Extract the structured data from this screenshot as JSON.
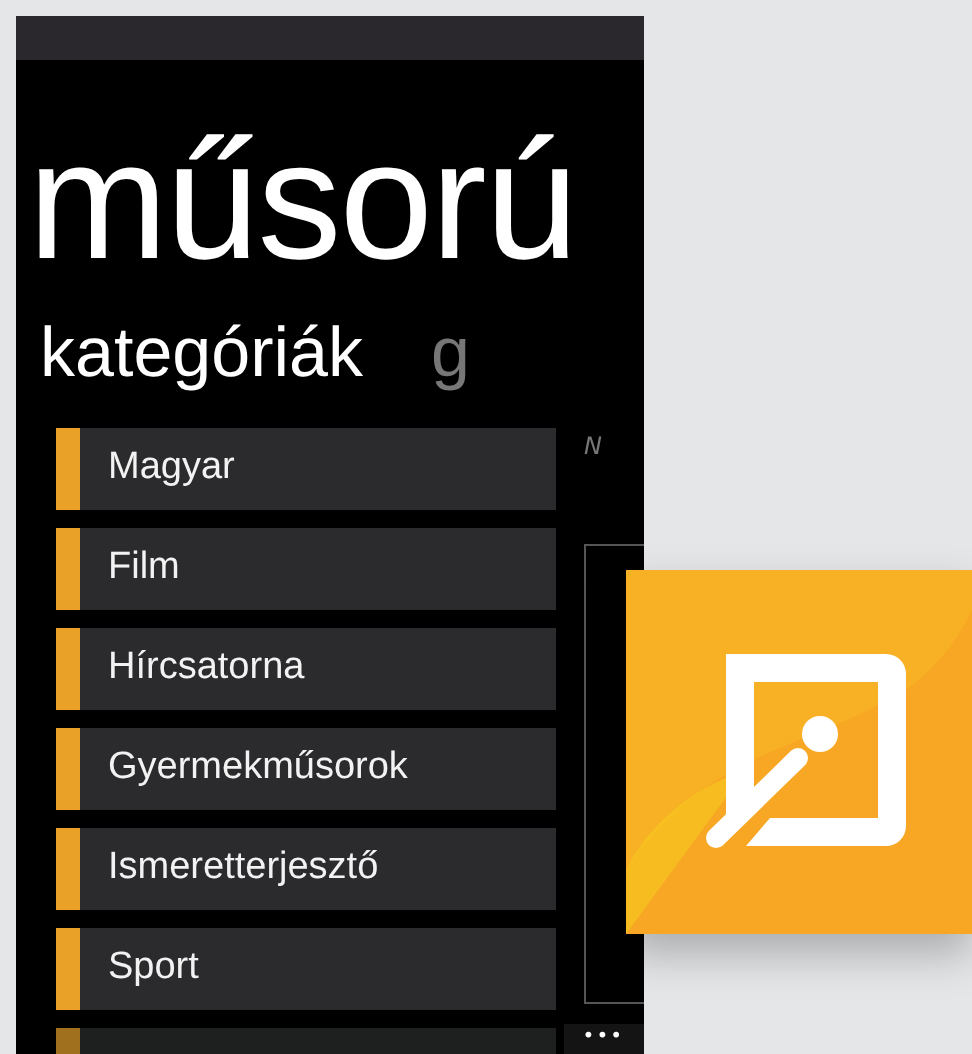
{
  "app_title": "műsorú",
  "pivot": {
    "headers": [
      {
        "label": "kategóriák",
        "selected": true
      },
      {
        "label": "g",
        "selected": false
      }
    ]
  },
  "categories": [
    {
      "label": "Magyar"
    },
    {
      "label": "Film"
    },
    {
      "label": "Hírcsatorna"
    },
    {
      "label": "Gyermekműsorok"
    },
    {
      "label": "Ismeretterjesztő"
    },
    {
      "label": "Sport"
    }
  ],
  "next_pane": {
    "caption": "N"
  },
  "app_bar": {
    "more": "•••"
  }
}
